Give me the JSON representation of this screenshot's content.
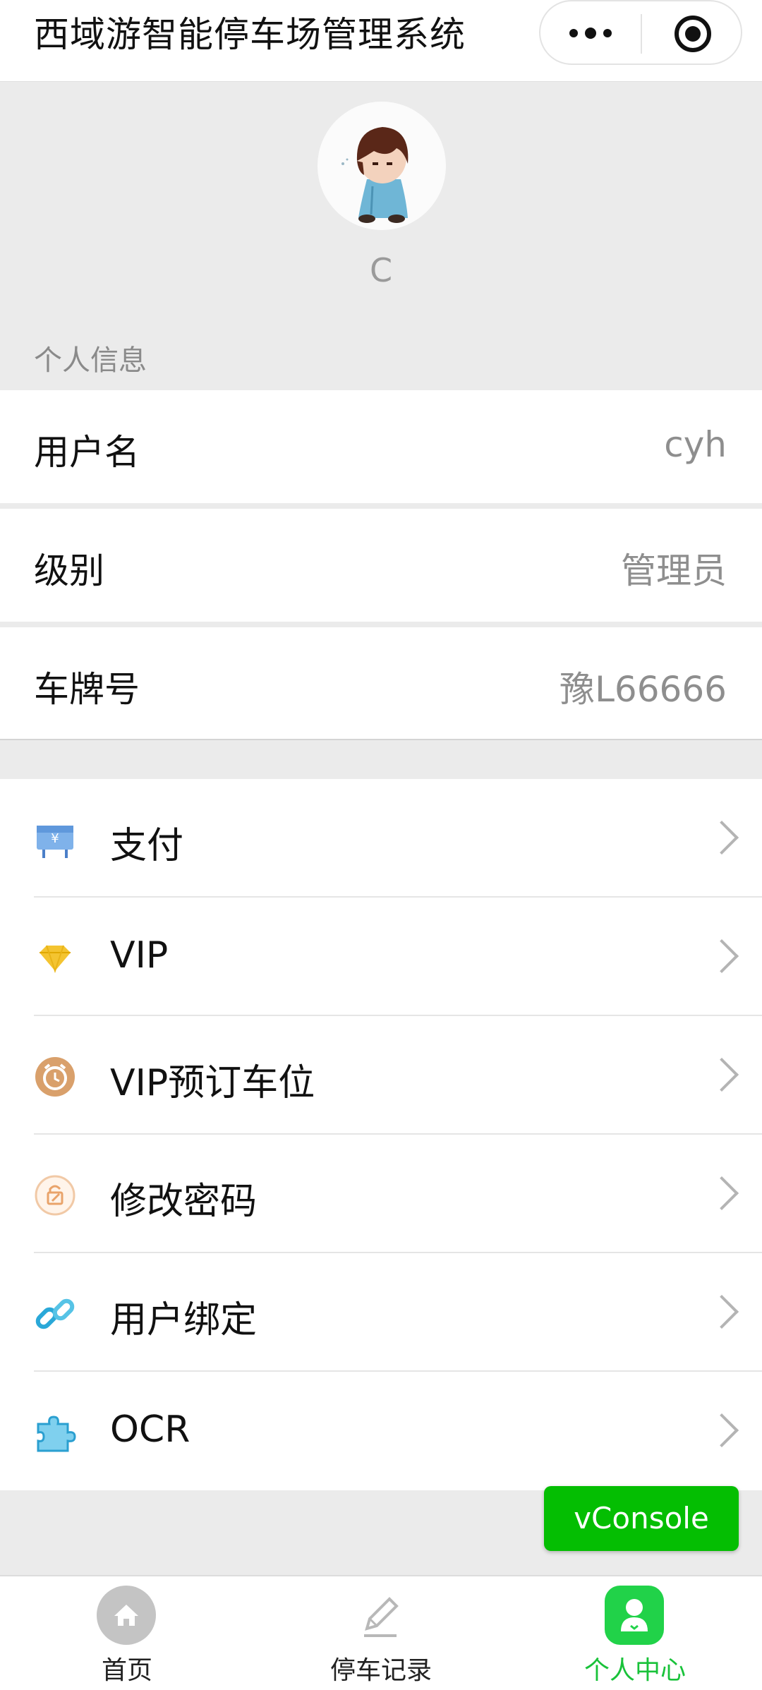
{
  "navbar": {
    "title": "西域游智能停车场管理系统"
  },
  "profile": {
    "nickname": "C",
    "section_label": "个人信息"
  },
  "info_rows": [
    {
      "label": "用户名",
      "value": "cyh"
    },
    {
      "label": "级别",
      "value": "管理员"
    },
    {
      "label": "车牌号",
      "value": "豫L66666"
    }
  ],
  "menu": [
    {
      "label": "支付",
      "icon": "payment-icon"
    },
    {
      "label": "VIP",
      "icon": "diamond-icon"
    },
    {
      "label": "VIP预订车位",
      "icon": "alarm-clock-icon"
    },
    {
      "label": "修改密码",
      "icon": "edit-lock-icon"
    },
    {
      "label": "用户绑定",
      "icon": "link-icon"
    },
    {
      "label": "OCR",
      "icon": "puzzle-icon"
    }
  ],
  "vconsole": {
    "label": "vConsole"
  },
  "tabbar": {
    "tabs": [
      {
        "label": "首页",
        "icon": "home-icon",
        "active": false
      },
      {
        "label": "停车记录",
        "icon": "pencil-icon",
        "active": false
      },
      {
        "label": "个人中心",
        "icon": "person-icon",
        "active": true
      }
    ]
  },
  "colors": {
    "active_tab": "#19c23a",
    "vconsole_bg": "#04be02",
    "background": "#ebebeb"
  }
}
